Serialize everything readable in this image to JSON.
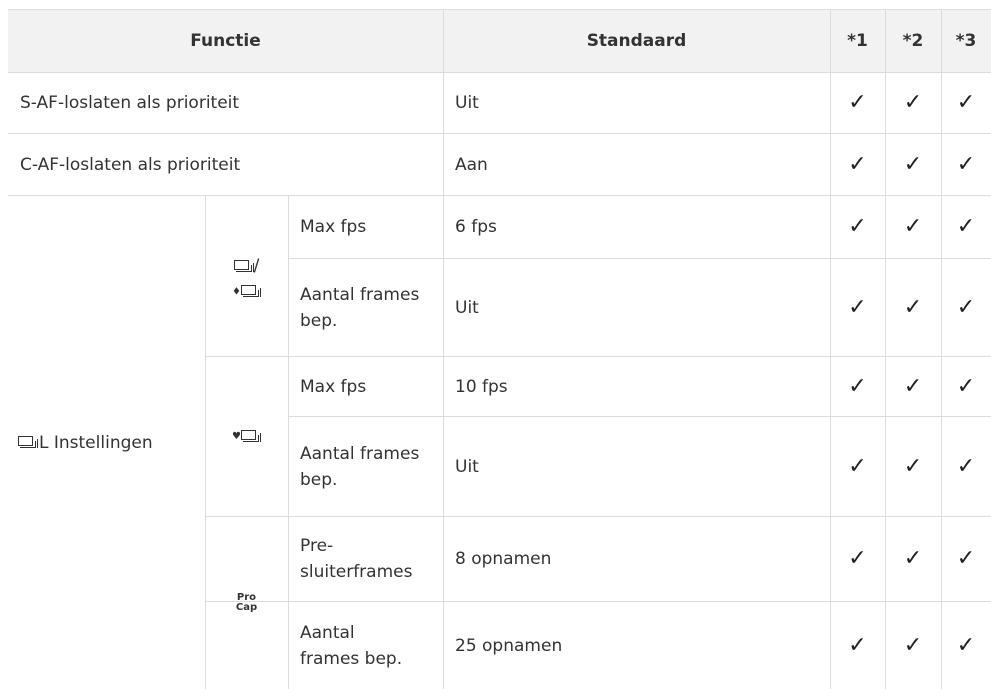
{
  "header": {
    "functie": "Functie",
    "standaard": "Standaard",
    "c1": "*1",
    "c2": "*2",
    "c3": "*3"
  },
  "check_glyph": "✓",
  "rows": [
    {
      "functie": "S-AF-loslaten als prioriteit",
      "standaard": "Uit"
    },
    {
      "functie": "C-AF-loslaten als prioriteit",
      "standaard": "Aan"
    }
  ],
  "group": {
    "label": "L Instellingen",
    "label_icon": "sequential-shooting-low-icon",
    "sub1": {
      "icon": "sequential-shooting-slash-silent-sequential-icon",
      "slash": "/",
      "items": [
        {
          "label": "Max fps",
          "standaard": "6 fps"
        },
        {
          "label": "Aantal frames bep.",
          "standaard": "Uit"
        }
      ]
    },
    "sub2": {
      "icon": "silent-sequential-shooting-icon",
      "items": [
        {
          "label": "Max fps",
          "standaard": "10 fps"
        },
        {
          "label": "Aantal frames bep.",
          "standaard": "Uit"
        }
      ]
    },
    "sub3": {
      "icon_text_top": "Pro",
      "icon_text_bottom": "Cap",
      "items": [
        {
          "label": "Pre-sluiterframes",
          "label_line1": "Pre-",
          "label_line2": "sluiterframes",
          "standaard": "8 opnamen"
        },
        {
          "label": "Aantal frames bep.",
          "label_line1": "Aantal",
          "label_line2": "frames bep.",
          "standaard": "25 opnamen"
        }
      ]
    }
  }
}
